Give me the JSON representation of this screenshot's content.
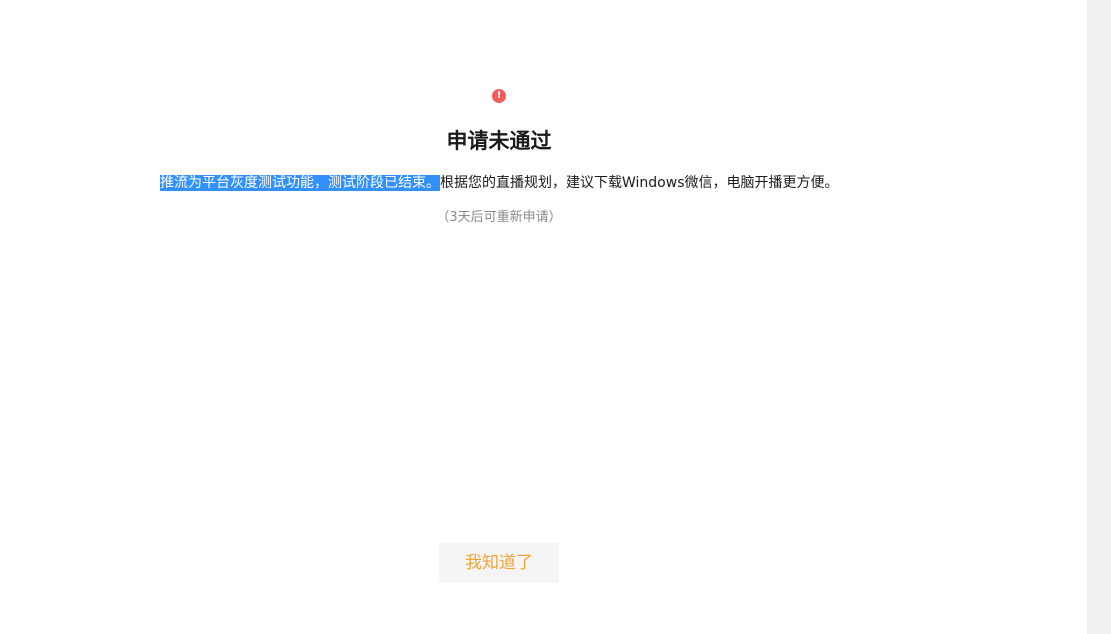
{
  "status": {
    "icon": "exclamation-circle-icon",
    "icon_glyph": "!",
    "icon_color": "#f25c5c",
    "title": "申请未通过"
  },
  "message": {
    "selected_text": "推流为平台灰度测试功能，测试阶段已结束。",
    "rest_text": "根据您的直播规划，建议下载Windows微信，电脑开播更方便。",
    "selection_color": "#3390ff"
  },
  "hint": "（3天后可重新申请）",
  "actions": {
    "ok_label": "我知道了",
    "ok_color": "#f2a33a"
  }
}
